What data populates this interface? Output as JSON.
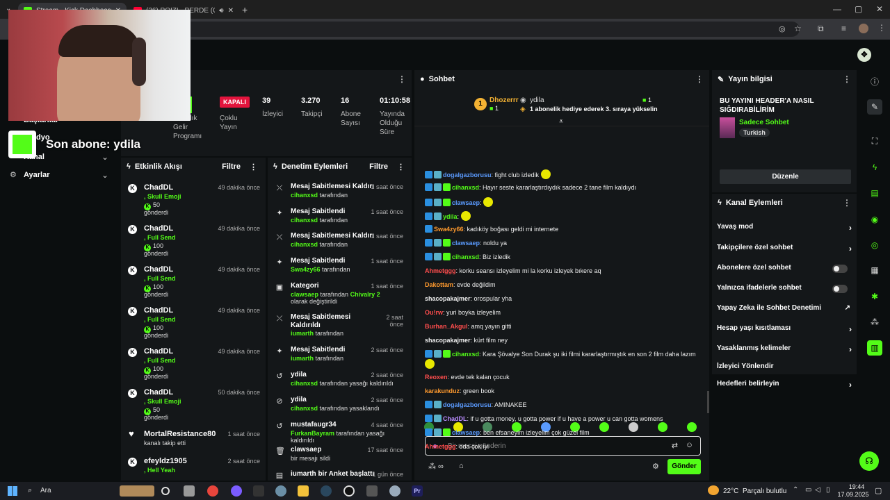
{
  "browser": {
    "tabs": [
      {
        "title": "Stream - Kick Dashboard",
        "active": true
      },
      {
        "title": "(36) POIZI - PERDE (Official",
        "active": false
      }
    ],
    "new_tab": "+",
    "win_min": "—",
    "win_max": "▢",
    "win_close": "✕"
  },
  "left_nav": {
    "items": [
      {
        "label": "Başlarılar"
      },
      {
        "label": "Kanal"
      },
      {
        "label": "Ayarlar"
      }
    ],
    "overlay_text": "Son abone: ydila",
    "overlay_prefix": "dyo"
  },
  "stats": {
    "partner_label": "Ortaklık\nGelir\nProgramı",
    "multistream_badge": "KAPALI",
    "multistream_label": "Çoklu\nYayın",
    "viewers_value": "39",
    "viewers_label": "İzleyici",
    "followers_value": "3.270",
    "followers_label": "Takipçi",
    "subs_value": "16",
    "subs_label": "Abone\nSayısı",
    "uptime_value": "01:10:58",
    "uptime_label": "Yayında\nOlduğu\nSüre"
  },
  "activity": {
    "title": "Etkinlik Akışı",
    "filter": "Filtre",
    "items": [
      {
        "name": "ChadDL",
        "time": "49 dakika önce",
        "reward": "Skull Emoji",
        "amount": "50",
        "verb": "gönderdi"
      },
      {
        "name": "ChadDL",
        "time": "49 dakika önce",
        "reward": "Full Send",
        "amount": "100",
        "verb": "gönderdi"
      },
      {
        "name": "ChadDL",
        "time": "49 dakika önce",
        "reward": "Full Send",
        "amount": "100",
        "verb": "gönderdi"
      },
      {
        "name": "ChadDL",
        "time": "49 dakika önce",
        "reward": "Full Send",
        "amount": "100",
        "verb": "gönderdi"
      },
      {
        "name": "ChadDL",
        "time": "49 dakika önce",
        "reward": "Full Send",
        "amount": "100",
        "verb": "gönderdi"
      },
      {
        "name": "ChadDL",
        "time": "50 dakika önce",
        "reward": "Skull Emoji",
        "amount": "50",
        "verb": "gönderdi"
      }
    ],
    "follow_name": "MortalResistance80",
    "follow_time": "1 saat önce",
    "follow_text": "kanalı takip etti",
    "last_name": "efeyldz1905",
    "last_time": "2 saat önce",
    "last_reward": "Hell Yeah"
  },
  "moderation": {
    "title": "Denetim Eylemleri",
    "filter": "Filtre",
    "items": [
      {
        "title": "Mesaj Sabitlemesi Kaldırıldı",
        "time": "1 saat önce",
        "user": "cihanxsd",
        "suffix": " tarafından"
      },
      {
        "title": "Mesaj Sabitlendi",
        "time": "1 saat önce",
        "user": "cihanxsd",
        "suffix": " tarafından"
      },
      {
        "title": "Mesaj Sabitlemesi Kaldırıldı",
        "time": "1 saat önce",
        "user": "cihanxsd",
        "suffix": " tarafından"
      },
      {
        "title": "Mesaj Sabitlendi",
        "time": "1 saat önce",
        "user": "Swa4zy66",
        "suffix": " tarafından"
      },
      {
        "title": "Kategori",
        "time": "1 saat önce",
        "user": "clawsaep",
        "suffix": " tarafından ",
        "extra_user": "Chivalry 2",
        "extra_text": " olarak değiştirildi"
      },
      {
        "title": "Mesaj Sabitlemesi Kaldırıldı",
        "time": "2 saat önce",
        "user": "iumarth",
        "suffix": " tarafından"
      },
      {
        "title": "Mesaj Sabitlendi",
        "time": "2 saat önce",
        "user": "iumarth",
        "suffix": " tarafından"
      },
      {
        "title": "ydila",
        "time": "2 saat önce",
        "user": "cihanxsd",
        "suffix": " tarafından yasağı kaldırıldı"
      },
      {
        "title": "ydila",
        "time": "2 saat önce",
        "user": "cihanxsd",
        "suffix": " tarafından yasaklandı"
      },
      {
        "title": "mustafaugr34",
        "time": "4 saat önce",
        "user": "FurkanBayram",
        "suffix": " tarafından yasağı kaldırıldı"
      },
      {
        "title": "clawsaep",
        "time": "17 saat önce",
        "user": "",
        "suffix": "bir mesajı sildi"
      },
      {
        "title": "iumarth bir Anket başlattı",
        "time": "1 gün önce",
        "user": "",
        "suffix": ""
      }
    ]
  },
  "chat": {
    "title": "Sohbet",
    "top_gifter_name": "Dhozerrr",
    "top_gifter_count": "1",
    "pinned_user": "ydila",
    "pinned_count": "1",
    "pinned_text": "1 abonelik hediye ederek 3. sıraya yükselin",
    "messages": [
      {
        "user": "dogalgazborusu",
        "color": "#5b9bff",
        "text": ": fight club izledik",
        "badges": 2
      },
      {
        "user": "cihanxsd",
        "color": "#53fc18",
        "text": ": Hayır seste kararlaştırdıydık sadece 2 tane film kaldıydı",
        "badges": 3
      },
      {
        "user": "clawsaep",
        "color": "#5b9bff",
        "text": ":",
        "badges": 3
      },
      {
        "user": "ydila",
        "color": "#53fc18",
        "text": ":",
        "badges": 2
      },
      {
        "user": "Swa4zy66",
        "color": "#ff9a2e",
        "text": ": kadıköy boğası geldi mi internete",
        "badges": 1
      },
      {
        "user": "clawsaep",
        "color": "#5b9bff",
        "text": ": noldu ya",
        "badges": 3
      },
      {
        "user": "cihanxsd",
        "color": "#53fc18",
        "text": ": Biz izledik",
        "badges": 3
      },
      {
        "user": "Ahmetggg",
        "color": "#ff4d4d",
        "text": ": korku seansı izleyelim mi la korku izleyek bıkere aq",
        "badges": 0
      },
      {
        "user": "Dakottam",
        "color": "#ff9a2e",
        "text": ": evde değildim",
        "badges": 0
      },
      {
        "user": "shacopakajmer",
        "color": "#f0f0f0",
        "text": ": orospular yha",
        "badges": 0
      },
      {
        "user": "Ou!rw",
        "color": "#ff4d4d",
        "text": ": yuri boyka izleyelim",
        "badges": 0
      },
      {
        "user": "Burhan_Akgul",
        "color": "#ff4d4d",
        "text": ": amq yayın gitti",
        "badges": 0
      },
      {
        "user": "shacopakajmer",
        "color": "#f0f0f0",
        "text": ": kürt film ney",
        "badges": 0
      },
      {
        "user": "cihanxsd",
        "color": "#53fc18",
        "text": ": Kara Şövalye Son Durak şu iki filmi kararlaştırmıştık en son 2 film daha lazım",
        "badges": 3
      },
      {
        "user": "Reoxen",
        "color": "#ff4d4d",
        "text": ": evde tek kalan çocuk",
        "badges": 0
      },
      {
        "user": "karakunduz",
        "color": "#ff9a2e",
        "text": ": green book",
        "badges": 0
      },
      {
        "user": "dogalgazborusu",
        "color": "#5b9bff",
        "text": ": AMINAKEE",
        "badges": 2
      },
      {
        "user": "ChadDL",
        "color": "#b98cff",
        "text": ": if u gotta money, u gotta power if u have a power u can gotta womens",
        "badges": 2
      },
      {
        "user": "clawsaep",
        "color": "#5b9bff",
        "text": ": ben efsaneyim izleyelim çok güzel film",
        "badges": 3
      },
      {
        "user": "Ahmetggg",
        "color": "#ff4d4d",
        "text": ": oda çok iyi",
        "badges": 0
      }
    ],
    "input_placeholder": "Bir mesaj gönderin",
    "send_label": "Gönder"
  },
  "stream_info": {
    "title": "Yayın bilgisi",
    "stream_title": "BU YAYINI HEADER'A NASIL SIĞDIRABİLİRİM",
    "category": "Sadece Sohbet",
    "language": "Turkish",
    "edit_label": "Düzenle"
  },
  "channel_actions": {
    "title": "Kanal Eylemleri",
    "items": [
      {
        "label": "Yavaş mod",
        "type": "arrow"
      },
      {
        "label": "Takipçilere özel sohbet",
        "type": "arrow"
      },
      {
        "label": "Abonelere özel sohbet",
        "type": "toggle"
      },
      {
        "label": "Yalnızca ifadelerle sohbet",
        "type": "toggle"
      },
      {
        "label": "Yapay Zeka ile Sohbet Denetimi",
        "type": "external"
      },
      {
        "label": "Hesap yaşı kısıtlaması",
        "type": "arrow"
      },
      {
        "label": "Yasaklanmış kelimeler",
        "type": "arrow"
      },
      {
        "label": "İzleyici Yönlendir",
        "type": "none"
      },
      {
        "label": "Hedefleri belirleyin",
        "type": "arrow"
      }
    ]
  },
  "taskbar": {
    "search_label": "Ara",
    "weather_temp": "22°C",
    "weather_text": "Parçalı bulutlu",
    "time": "19:44",
    "date": "17.09.2025"
  },
  "colors": {
    "accent": "#53fc18",
    "panel": "#141719",
    "background": "#0b0e0f"
  }
}
